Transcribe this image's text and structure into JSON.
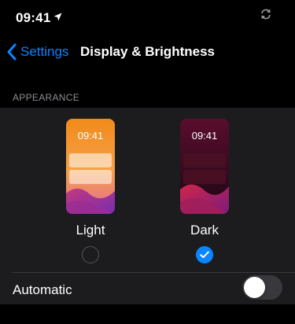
{
  "status_bar": {
    "time": "09:41",
    "location_icon": "location-arrow-icon",
    "sync_icon": "sync-icon"
  },
  "nav": {
    "back_label": "Settings",
    "back_icon": "chevron-left-icon",
    "title": "Display & Brightness"
  },
  "appearance": {
    "section_header": "APPEARANCE",
    "options": [
      {
        "label": "Light",
        "preview_time": "09:41",
        "selected": false
      },
      {
        "label": "Dark",
        "preview_time": "09:41",
        "selected": true
      }
    ],
    "automatic": {
      "label": "Automatic",
      "enabled": false
    }
  },
  "colors": {
    "accent": "#0a84ff",
    "background": "#000000",
    "group_background": "#1c1c1e",
    "secondary_text": "#8d8d93"
  }
}
